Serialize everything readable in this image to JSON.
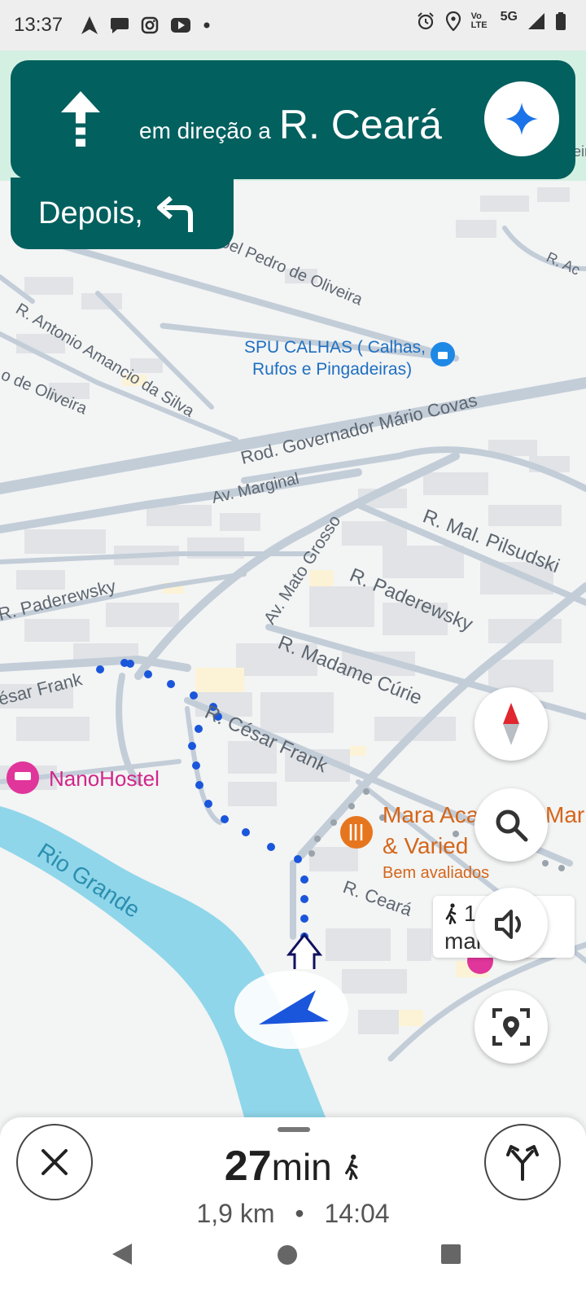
{
  "status_bar": {
    "time": "13:37",
    "left_icons": [
      "navigation-icon",
      "chat-icon",
      "instagram-icon",
      "youtube-icon",
      "dot-icon"
    ],
    "right_icons": [
      "alarm-icon",
      "location-icon",
      "volte-icon",
      "5g-icon",
      "signal-icon",
      "battery-icon"
    ],
    "volte_label": "Vo LTE",
    "network_label": "5G"
  },
  "navigation": {
    "toward_label": "em direção a",
    "street": "R. Ceará",
    "then_label": "Depois,",
    "maneuver_icon": "straight-arrow-icon",
    "then_icon": "turn-left-icon",
    "assistant_icon": "gemini-sparkle-icon"
  },
  "map": {
    "labels": {
      "pedro": "oel Pedro de Oliveira",
      "racl": "R. Ac",
      "antonio": "R. Antonio Amancio da Silva",
      "oliveira": "o de Oliveira",
      "spu1": "SPU CALHAS ( Calhas,",
      "spu2": "Rufos e Pingadeiras)",
      "rod": "Rod. Governador Mário Covas",
      "marginal": "Av. Marginal",
      "pilsudski": "R. Mal. Pilsudski",
      "mato": "Av. Mato Grosso",
      "paderewsky1": "R. Paderewsky",
      "paderewsky2": "R. Paderewsky",
      "madame": "R. Madame Cúrie",
      "cesar1": "ésar Frank",
      "cesar2": "R. César Frank",
      "hostel": "NanoHostel",
      "mara1": "Mara Aca",
      "mara2": "Mar",
      "varied": "& Varied",
      "bem": "Bem avaliados",
      "ceara": "R. Ceará",
      "rio": "Rio Grande",
      "ein": "ein"
    },
    "colors": {
      "nav_teal": "#02605f",
      "route_blue": "#1a56db",
      "river": "#8fd6ea",
      "road": "#c2cdd8",
      "poi_orange": "#e6761e",
      "poi_pink": "#e0359a",
      "poi_blue": "#1e88e5"
    }
  },
  "walk_chip": {
    "line1": "1mi",
    "line2": "mai",
    "icon": "walking-person-icon"
  },
  "controls": {
    "compass_icon": "compass-icon",
    "search_icon": "search-icon",
    "sound_icon": "volume-icon",
    "recenter_icon": "recenter-location-icon"
  },
  "trip": {
    "eta_value": "27",
    "eta_unit": "min",
    "mode_icon": "walking-person-icon",
    "distance": "1,9 km",
    "separator": "•",
    "arrival": "14:04",
    "close_icon": "close-icon",
    "routes_icon": "route-options-icon"
  },
  "system_nav": {
    "back_icon": "back-triangle-icon",
    "home_icon": "home-circle-icon",
    "recents_icon": "recents-square-icon"
  }
}
